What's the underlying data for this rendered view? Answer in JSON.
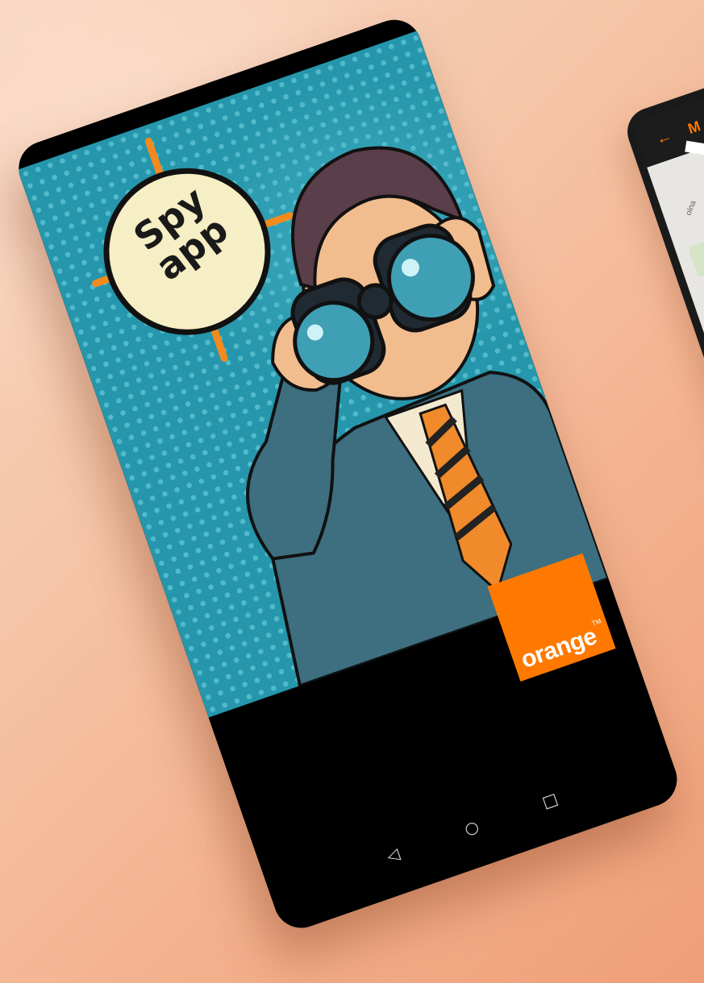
{
  "splash": {
    "badge_line1": "Spy",
    "badge_line2": "app",
    "brand_name": "orange",
    "brand_tm": "TM",
    "brand_color": "#ff7900",
    "art_background": "#2596ab"
  },
  "navbar": {
    "back_icon": "◁",
    "home_icon": "○",
    "recent_icon": "□"
  },
  "second_phone": {
    "back_icon": "←",
    "title_partial": "M",
    "map_label": "olna"
  }
}
